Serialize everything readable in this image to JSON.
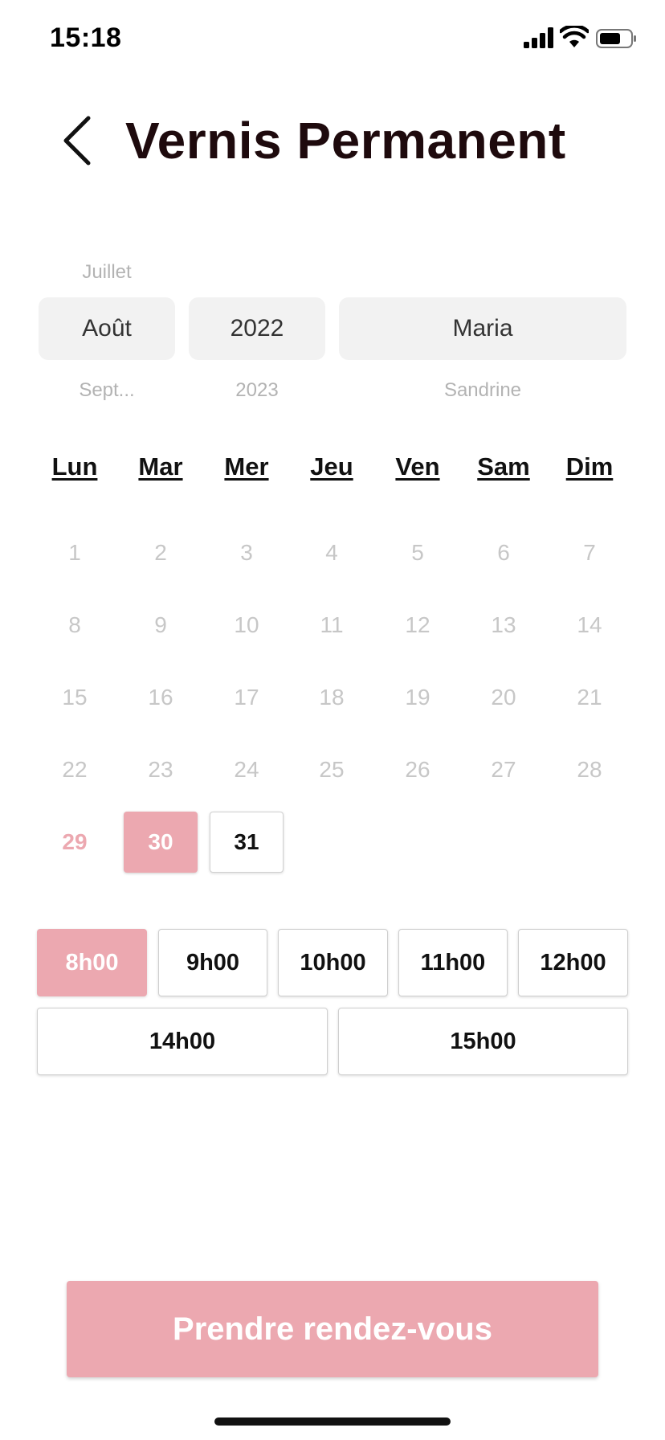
{
  "status_bar": {
    "time": "15:18"
  },
  "header": {
    "title": "Vernis Permanent"
  },
  "pickers": {
    "month": {
      "prev": "Juillet",
      "selected": "Août",
      "next": "Sept..."
    },
    "year": {
      "selected": "2022",
      "next": "2023"
    },
    "staff": {
      "selected": "Maria",
      "next": "Sandrine"
    }
  },
  "weekdays": [
    "Lun",
    "Mar",
    "Mer",
    "Jeu",
    "Ven",
    "Sam",
    "Dim"
  ],
  "calendar": {
    "days": [
      "1",
      "2",
      "3",
      "4",
      "5",
      "6",
      "7",
      "8",
      "9",
      "10",
      "11",
      "12",
      "13",
      "14",
      "15",
      "16",
      "17",
      "18",
      "19",
      "20",
      "21",
      "22",
      "23",
      "24",
      "25",
      "26",
      "27",
      "28",
      "29",
      "30",
      "31"
    ],
    "today": "29",
    "selected": "30",
    "available": [
      "30",
      "31"
    ]
  },
  "time_slots": [
    "8h00",
    "9h00",
    "10h00",
    "11h00",
    "12h00",
    "14h00",
    "15h00"
  ],
  "selected_slot": "8h00",
  "cta": {
    "label": "Prendre rendez-vous"
  },
  "colors": {
    "accent": "#eca8b0",
    "title": "#1e0a0d",
    "disabled_day": "#c7c7c7",
    "picker_bg": "#f2f2f2"
  }
}
